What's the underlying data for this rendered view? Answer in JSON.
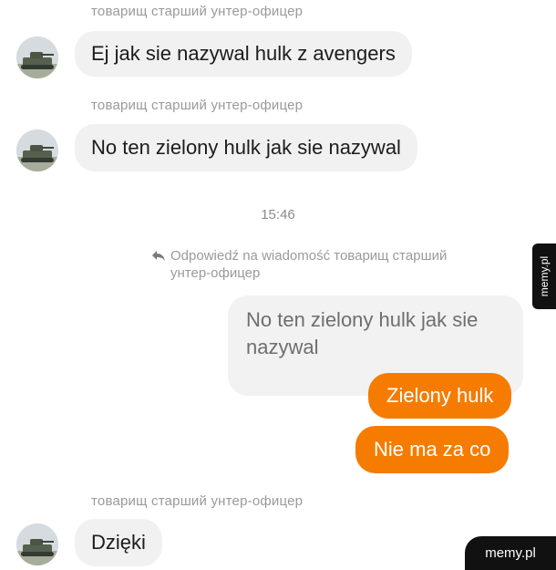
{
  "messages": [
    {
      "sender": "товарищ старший унтер-офицер",
      "text": "Ej jak sie nazywal hulk z avengers"
    },
    {
      "sender": "товарищ старший унтер-офицер",
      "text": "No ten zielony hulk jak sie nazywal"
    },
    {
      "sender": "товарищ старший унтер-офицер",
      "text": "Dzięki"
    }
  ],
  "timestamp": "15:46",
  "reply": {
    "header": "Odpowiedź na wiadomość товарищ старший унтер-офицер",
    "quoted_text": "No ten zielony hulk jak sie nazywal",
    "icon": "reply-arrow-icon"
  },
  "outgoing": [
    {
      "text": "Zielony hulk"
    },
    {
      "text": "Nie ma za co"
    }
  ],
  "watermark": {
    "side_tab": "memy.pl",
    "corner": "memy.pl"
  },
  "colors": {
    "outgoing_bubble": "#f57c00",
    "incoming_bubble": "#f1f1f1",
    "watermark": "#111111"
  }
}
